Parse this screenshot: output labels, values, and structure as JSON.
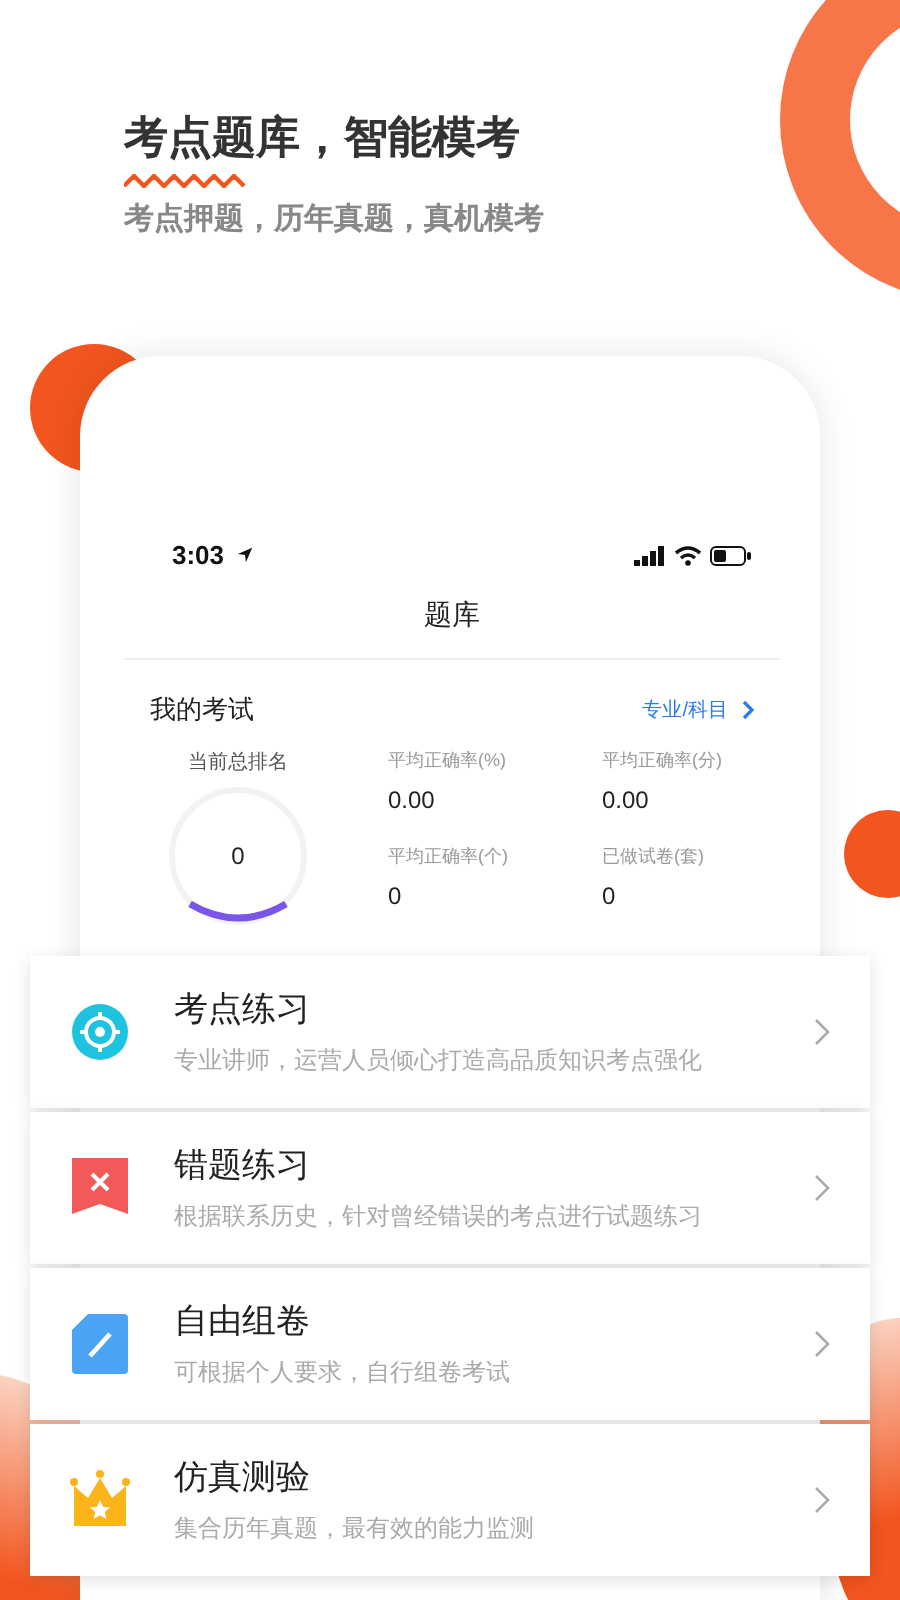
{
  "headline": {
    "title": "考点题库，智能模考",
    "subtitle": "考点押题，历年真题，真机模考"
  },
  "phone": {
    "status_bar": {
      "time": "3:03"
    },
    "title": "题库",
    "section": {
      "title": "我的考试",
      "link": "专业/科目"
    },
    "rank": {
      "label": "当前总排名",
      "value": "0"
    },
    "stats": [
      {
        "label": "平均正确率(%)",
        "value": "0.00"
      },
      {
        "label": "平均正确率(分)",
        "value": "0.00"
      },
      {
        "label": "平均正确率(个)",
        "value": "0"
      },
      {
        "label": "已做试卷(套)",
        "value": "0"
      }
    ]
  },
  "features": [
    {
      "kind": "target",
      "title": "考点练习",
      "description": "专业讲师，运营人员倾心打造高品质知识考点强化"
    },
    {
      "kind": "mistake",
      "title": "错题练习",
      "description": "根据联系历史，针对曾经错误的考点进行试题练习"
    },
    {
      "kind": "compose",
      "title": "自由组卷",
      "description": "可根据个人要求，自行组卷考试"
    },
    {
      "kind": "simulation",
      "title": "仿真测验",
      "description": "集合历年真题，最有效的能力监测"
    }
  ]
}
